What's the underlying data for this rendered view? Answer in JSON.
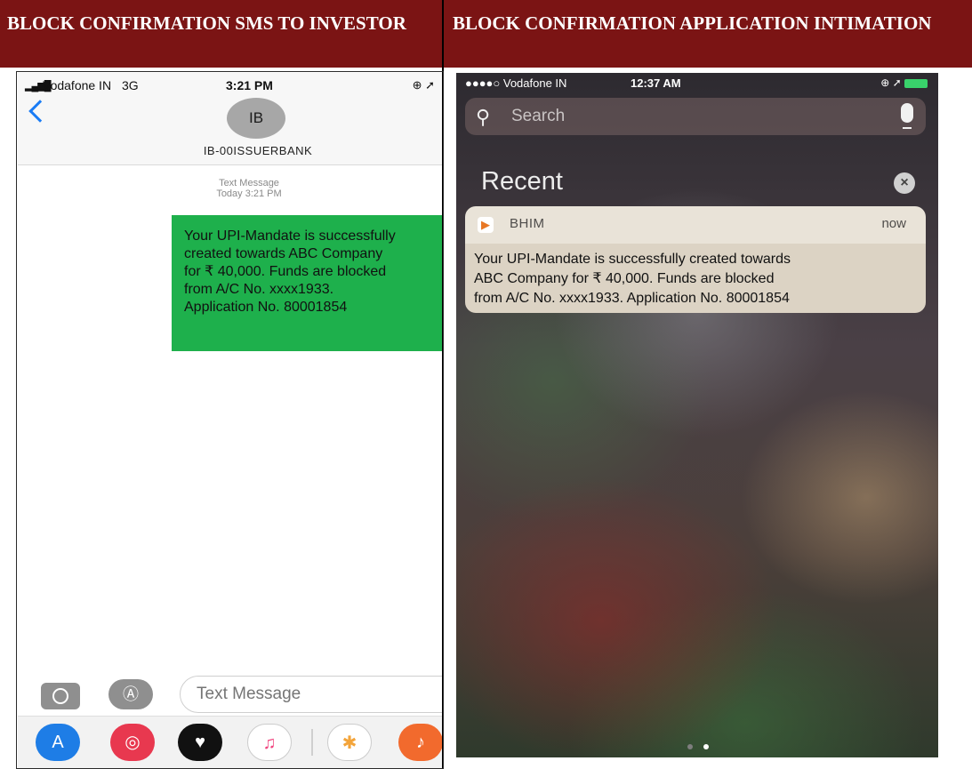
{
  "headers": {
    "left": "BLOCK CONFIRMATION SMS TO INVESTOR",
    "right": "BLOCK CONFIRMATION APPLICATION INTIMATION"
  },
  "sms_screen": {
    "status": {
      "carrier": "Vodafone IN",
      "network": "3G",
      "time": "3:21 PM",
      "icons": "⊕ ➚"
    },
    "avatar_initials": "IB",
    "sender": "IB-00ISSUERBANK",
    "message_meta": {
      "type": "Text Message",
      "timestamp": "Today 3:21 PM"
    },
    "message_lines": [
      "Your UPI-Mandate is successfully",
      "created towards ABC Company",
      "for ₹ 40,000. Funds are blocked",
      "from A/C No. xxxx1933.",
      "Application No. 80001854"
    ],
    "input_placeholder": "Text Message",
    "dock_icons": [
      "app-store-icon",
      "search-globe-icon",
      "heart-icon",
      "music-icon",
      "photos-icon",
      "guitar-icon"
    ]
  },
  "notification_screen": {
    "status": {
      "carrier": "●●●●○ Vodafone IN",
      "time": "12:37 AM"
    },
    "search_placeholder": "Search",
    "section_title": "Recent",
    "notification": {
      "app": "BHIM",
      "time": "now",
      "lines": [
        "Your UPI-Mandate is successfully created towards",
        "ABC Company for ₹ 40,000. Funds are blocked",
        "from A/C No. xxxx1933. Application No. 80001854"
      ]
    }
  },
  "colors": {
    "header_bg": "#7b1414",
    "bubble": "#1eb04c",
    "ios_blue": "#1a7cf5"
  }
}
